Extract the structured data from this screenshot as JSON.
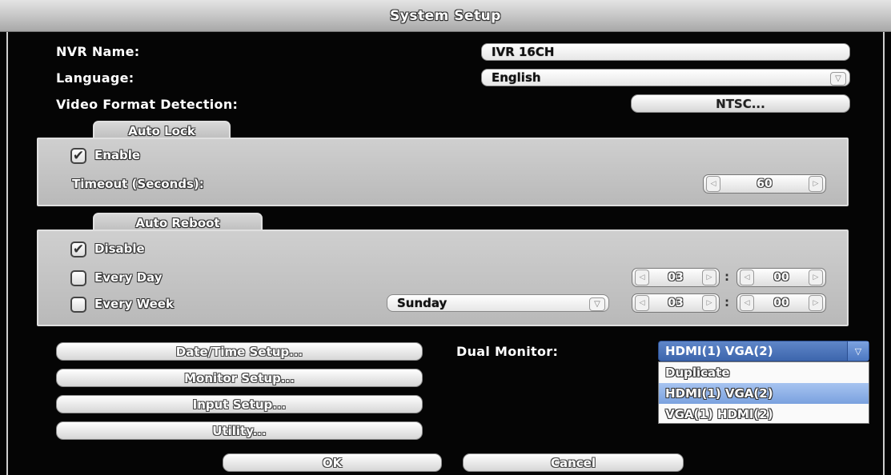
{
  "window": {
    "title": "System Setup"
  },
  "fields": {
    "nvr_name": {
      "label": "NVR Name:",
      "value": "IVR 16CH"
    },
    "language": {
      "label": "Language:",
      "value": "English"
    },
    "video_format": {
      "label": "Video Format Detection:",
      "button": "NTSC..."
    }
  },
  "auto_lock": {
    "title": "Auto Lock",
    "enable_label": "Enable",
    "enable_checked": true,
    "timeout_label": "Timeout (Seconds):",
    "timeout_value": "60"
  },
  "auto_reboot": {
    "title": "Auto Reboot",
    "disable_label": "Disable",
    "disable_checked": true,
    "every_day_label": "Every Day",
    "every_day_checked": false,
    "every_day_hour": "03",
    "every_day_minute": "00",
    "every_week_label": "Every Week",
    "every_week_checked": false,
    "every_week_day": "Sunday",
    "every_week_hour": "03",
    "every_week_minute": "00",
    "separator": ":"
  },
  "setup_buttons": {
    "date_time": "Date/Time Setup...",
    "monitor": "Monitor Setup...",
    "input": "Input Setup...",
    "utility": "Utility..."
  },
  "dual_monitor": {
    "label": "Dual Monitor:",
    "selected": "HDMI(1) VGA(2)",
    "options": [
      "Duplicate",
      "HDMI(1) VGA(2)",
      "VGA(1) HDMI(2)"
    ],
    "selected_index": 1
  },
  "footer": {
    "ok": "OK",
    "cancel": "Cancel"
  },
  "icons": {
    "check": "✔",
    "left_arrow": "◁",
    "right_arrow": "▷",
    "down_arrow": "▽"
  }
}
